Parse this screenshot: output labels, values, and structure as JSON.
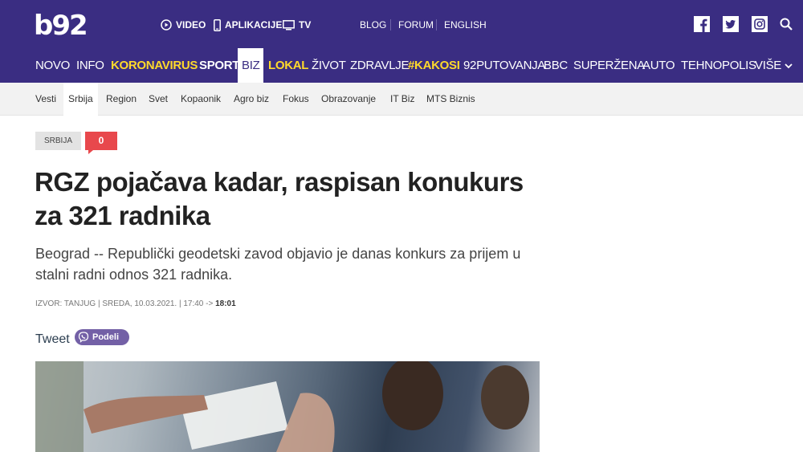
{
  "header": {
    "logo": "b92",
    "links": {
      "video": "VIDEO",
      "apps": "APLIKACIJE",
      "tv": "TV",
      "blog": "BLOG",
      "forum": "FORUM",
      "english": "ENGLISH"
    },
    "social_icons": [
      "facebook-icon",
      "twitter-icon",
      "instagram-icon",
      "search-icon"
    ]
  },
  "main_nav": [
    {
      "label": "NOVO"
    },
    {
      "label": "INFO"
    },
    {
      "label": "KORONAVIRUS"
    },
    {
      "label": "SPORT"
    },
    {
      "label": "BIZ"
    },
    {
      "label": "LOKAL"
    },
    {
      "label": "ŽIVOT"
    },
    {
      "label": "ZDRAVLJE"
    },
    {
      "label": "#KAKOSI"
    },
    {
      "label": "92PUTOVANJA"
    },
    {
      "label": "BBC"
    },
    {
      "label": "SUPERŽENA"
    },
    {
      "label": "AUTO"
    },
    {
      "label": "TEHNOPOLIS"
    },
    {
      "label": "VIŠE"
    }
  ],
  "sub_nav": [
    {
      "label": "Vesti"
    },
    {
      "label": "Srbija"
    },
    {
      "label": "Region"
    },
    {
      "label": "Svet"
    },
    {
      "label": "Kopaonik"
    },
    {
      "label": "Agro biz"
    },
    {
      "label": "Fokus"
    },
    {
      "label": "Obrazovanje"
    },
    {
      "label": "IT Biz"
    },
    {
      "label": "MTS Biznis"
    }
  ],
  "article": {
    "category": "SRBIJA",
    "comments": "0",
    "title": "RGZ pojačava kadar, raspisan konukurs za 321 radnika",
    "lead": "Beograd -- Republički geodetski zavod objavio je danas konkurs za prijem u stalni radni odnos 321 radnika.",
    "meta": "IZVOR: TANJUG | SREDA, 10.03.2021. | 17:40 ->",
    "updated": "18:01"
  },
  "share": {
    "tweet": "Tweet",
    "viber": "Podeli"
  },
  "colors": {
    "brand": "#3a2d82",
    "highlight": "#ffd92b",
    "comment": "#e8484c",
    "viber": "#7360a6"
  }
}
